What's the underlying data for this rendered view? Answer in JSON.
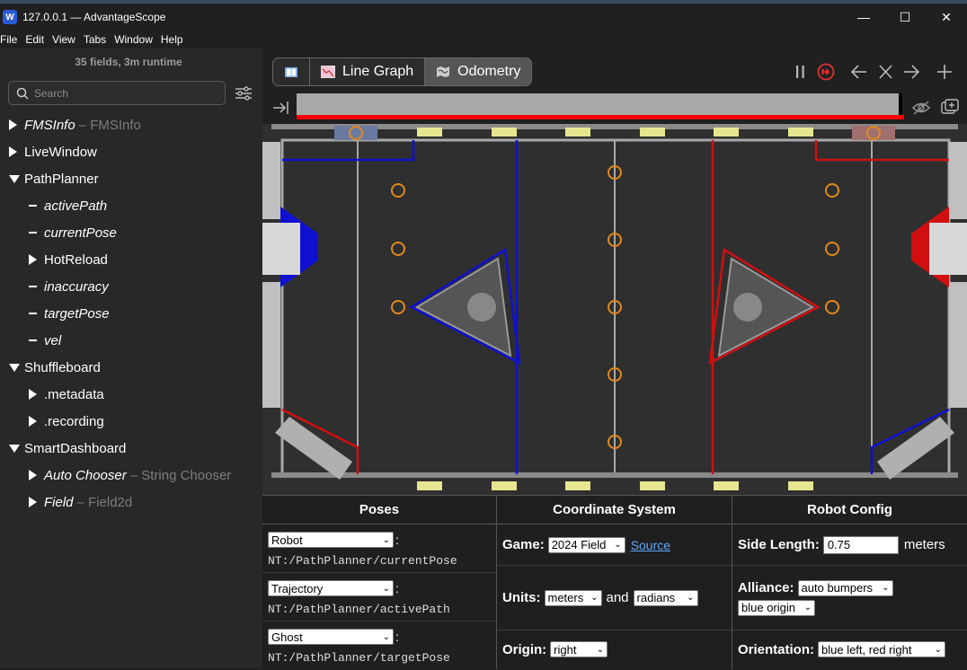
{
  "window": {
    "title": "127.0.0.1 — AdvantageScope",
    "icon_letter": "W",
    "min": "—",
    "max": "☐",
    "close": "✕"
  },
  "menu": [
    "File",
    "Edit",
    "View",
    "Tabs",
    "Window",
    "Help"
  ],
  "sidebar": {
    "runtime": "35 fields, 3m runtime",
    "search_placeholder": "Search",
    "tree": [
      {
        "label": "FMSInfo",
        "sub": "– FMSInfo",
        "italic": true,
        "level": 0,
        "kind": "collapsed"
      },
      {
        "label": "LiveWindow",
        "sub": "",
        "italic": false,
        "level": 0,
        "kind": "collapsed"
      },
      {
        "label": "PathPlanner",
        "sub": "",
        "italic": false,
        "level": 0,
        "kind": "expanded"
      },
      {
        "label": "activePath",
        "sub": "",
        "italic": true,
        "level": 1,
        "kind": "leaf"
      },
      {
        "label": "currentPose",
        "sub": "",
        "italic": true,
        "level": 1,
        "kind": "leaf"
      },
      {
        "label": "HotReload",
        "sub": "",
        "italic": false,
        "level": 1,
        "kind": "collapsed"
      },
      {
        "label": "inaccuracy",
        "sub": "",
        "italic": true,
        "level": 1,
        "kind": "leaf"
      },
      {
        "label": "targetPose",
        "sub": "",
        "italic": true,
        "level": 1,
        "kind": "leaf"
      },
      {
        "label": "vel",
        "sub": "",
        "italic": true,
        "level": 1,
        "kind": "leaf"
      },
      {
        "label": "Shuffleboard",
        "sub": "",
        "italic": false,
        "level": 0,
        "kind": "expanded"
      },
      {
        "label": ".metadata",
        "sub": "",
        "italic": false,
        "level": 1,
        "kind": "collapsed"
      },
      {
        "label": ".recording",
        "sub": "",
        "italic": false,
        "level": 1,
        "kind": "collapsed"
      },
      {
        "label": "SmartDashboard",
        "sub": "",
        "italic": false,
        "level": 0,
        "kind": "expanded"
      },
      {
        "label": "Auto Chooser",
        "sub": "– String Chooser",
        "italic": true,
        "level": 1,
        "kind": "collapsed"
      },
      {
        "label": "Field",
        "sub": "– Field2d",
        "italic": true,
        "level": 1,
        "kind": "collapsed"
      }
    ]
  },
  "tabs": [
    {
      "label": "",
      "icon": "book-icon",
      "active": false
    },
    {
      "label": "Line Graph",
      "icon": "line-graph-icon",
      "active": false
    },
    {
      "label": "Odometry",
      "icon": "map-icon",
      "active": true
    }
  ],
  "controls": [
    "pause-icon",
    "live-icon",
    "tab-left-icon",
    "close-tab-icon",
    "tab-right-icon",
    "add-tab-icon"
  ],
  "colors": {
    "blue_alliance": "#1010d0",
    "red_alliance": "#d01010",
    "timeline_red": "#ff0000",
    "note": "#e08a1e"
  },
  "panels": {
    "poses": {
      "header": "Poses",
      "rows": [
        {
          "type": "Robot",
          "path": "NT:/PathPlanner/currentPose"
        },
        {
          "type": "Trajectory",
          "path": "NT:/PathPlanner/activePath"
        },
        {
          "type": "Ghost",
          "path": "NT:/PathPlanner/targetPose"
        }
      ]
    },
    "coords": {
      "header": "Coordinate System",
      "game_label": "Game:",
      "game_value": "2024 Field",
      "source_link": "Source",
      "units_label": "Units:",
      "units_length": "meters",
      "and": "and",
      "units_angle": "radians",
      "origin_label": "Origin:",
      "origin_value": "right"
    },
    "robot": {
      "header": "Robot Config",
      "side_label": "Side Length:",
      "side_value": "0.75",
      "side_unit": "meters",
      "alliance_label": "Alliance:",
      "alliance_value": "auto bumpers",
      "alliance_origin": "blue origin",
      "orientation_label": "Orientation:",
      "orientation_value": "blue left, red right"
    }
  }
}
